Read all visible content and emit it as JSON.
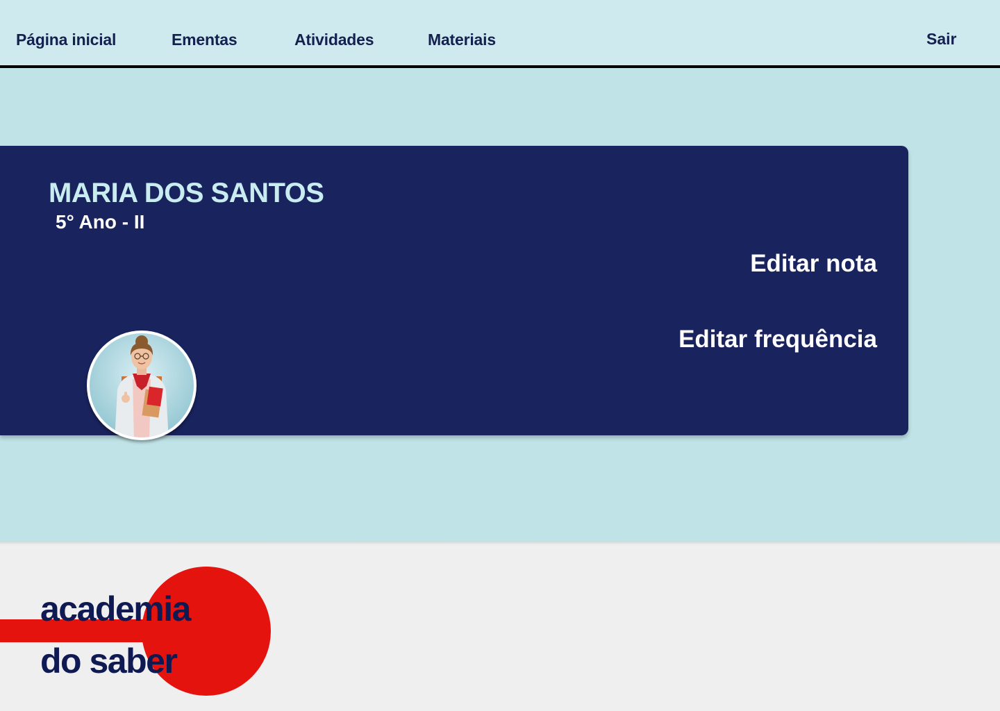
{
  "nav": {
    "items": [
      {
        "label": "Página inicial"
      },
      {
        "label": "Ementas"
      },
      {
        "label": "Atividades"
      },
      {
        "label": "Materiais"
      }
    ],
    "logout_label": "Sair"
  },
  "student": {
    "name": "MARIA DOS SANTOS",
    "class": "5° Ano - II",
    "avatar_icon": "student-photo"
  },
  "actions": {
    "edit_grade": "Editar nota",
    "edit_attendance": "Editar frequência"
  },
  "footer": {
    "logo_line1": "academia",
    "logo_line2": "do saber"
  },
  "colors": {
    "nav_bg": "#cfeaee",
    "main_bg": "#c0e3e7",
    "card_bg": "#19235d",
    "accent_red": "#e5130e",
    "text_dark": "#14204f"
  }
}
